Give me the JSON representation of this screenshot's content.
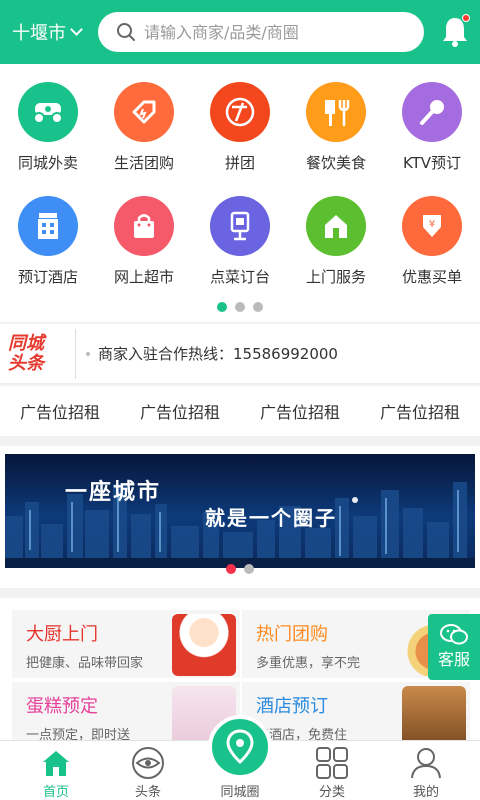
{
  "header": {
    "city": "十堰市",
    "search_placeholder": "请输入商家/品类/商圈"
  },
  "categories": [
    {
      "label": "同城外卖",
      "icon": "scooter-icon",
      "color": "#19c28a"
    },
    {
      "label": "生活团购",
      "icon": "tag-icon",
      "color": "#ff6b3d"
    },
    {
      "label": "拼团",
      "icon": "group-icon",
      "color": "#f5471e"
    },
    {
      "label": "餐饮美食",
      "icon": "dining-icon",
      "color": "#ff9c1a"
    },
    {
      "label": "KTV预订",
      "icon": "microphone-icon",
      "color": "#a56ce0"
    },
    {
      "label": "预订酒店",
      "icon": "hotel-icon",
      "color": "#3f8ef5"
    },
    {
      "label": "网上超市",
      "icon": "shopping-bag-icon",
      "color": "#f45a6a"
    },
    {
      "label": "点菜订台",
      "icon": "table-number-icon",
      "color": "#6b64e0"
    },
    {
      "label": "上门服务",
      "icon": "home-service-icon",
      "color": "#5bbf2f"
    },
    {
      "label": "优惠买单",
      "icon": "discount-pay-icon",
      "color": "#ff6a3d"
    }
  ],
  "carousel": {
    "pages": 3,
    "active": 0
  },
  "headline": {
    "logo_line1": "同城",
    "logo_line2": "头条",
    "text": "商家入驻合作热线：15586992000"
  },
  "ad_slots": [
    "广告位招租",
    "广告位招租",
    "广告位招租",
    "广告位招租"
  ],
  "banner": {
    "line1": "一座城市",
    "line2": "就是一个圈子",
    "pages": 2,
    "active": 0
  },
  "cards": [
    {
      "title": "大厨上门",
      "subtitle": "把健康、品味带回家",
      "title_color": "#e8322c"
    },
    {
      "title": "热门团购",
      "subtitle": "多重优惠，享不完",
      "title_color": "#ff8a1e"
    },
    {
      "title": "蛋糕预定",
      "subtitle": "一点预定，即时送",
      "title_color": "#e8409a"
    },
    {
      "title": "酒店预订",
      "subtitle": "华酒店，免费住",
      "title_color": "#2b8be0"
    }
  ],
  "kefu": "客服",
  "nav": {
    "items": [
      "首页",
      "头条",
      "同城圈",
      "分类",
      "我的"
    ],
    "active": 0
  },
  "colors": {
    "primary": "#19c28a"
  }
}
